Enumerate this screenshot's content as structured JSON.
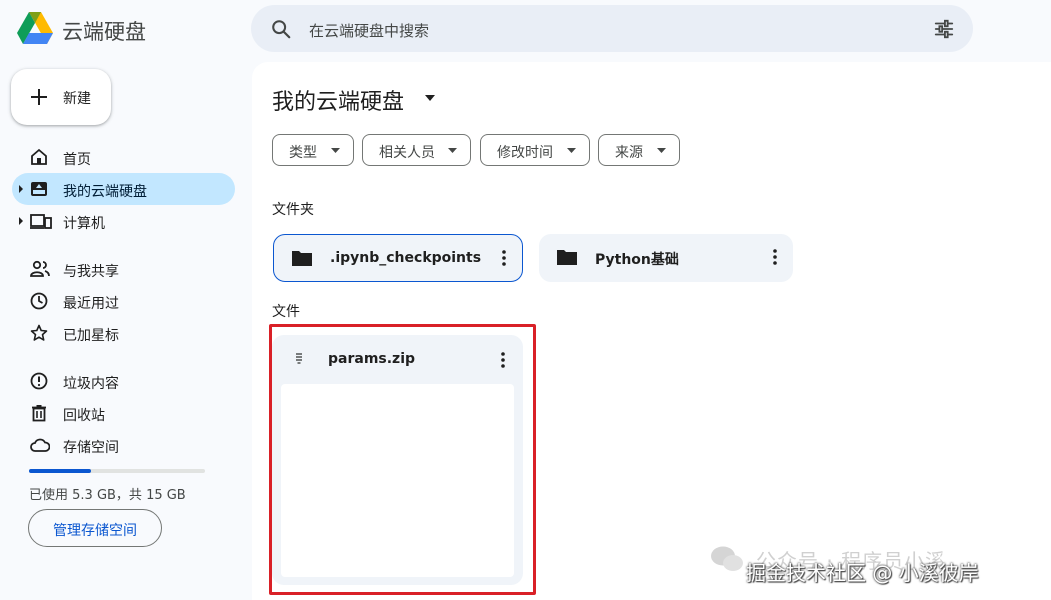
{
  "header": {
    "app_title": "云端硬盘",
    "search_placeholder": "在云端硬盘中搜索"
  },
  "sidebar": {
    "new_label": "新建",
    "items": [
      {
        "label": "首页",
        "icon": "home-icon"
      },
      {
        "label": "我的云端硬盘",
        "icon": "my-drive-icon",
        "active": true
      },
      {
        "label": "计算机",
        "icon": "computer-icon"
      },
      {
        "label": "与我共享",
        "icon": "shared-icon"
      },
      {
        "label": "最近用过",
        "icon": "clock-icon"
      },
      {
        "label": "已加星标",
        "icon": "star-icon"
      },
      {
        "label": "垃圾内容",
        "icon": "spam-icon"
      },
      {
        "label": "回收站",
        "icon": "trash-icon"
      },
      {
        "label": "存储空间",
        "icon": "cloud-icon"
      }
    ],
    "storage": {
      "text": "已使用 5.3 GB，共 15 GB",
      "used_fraction": 0.353,
      "manage_label": "管理存储空间"
    }
  },
  "main": {
    "title": "我的云端硬盘",
    "filters": [
      "类型",
      "相关人员",
      "修改时间",
      "来源"
    ],
    "folders_label": "文件夹",
    "folders": [
      {
        "name": ".ipynb_checkpoints",
        "selected": true
      },
      {
        "name": "Python基础",
        "selected": false
      }
    ],
    "files_label": "文件",
    "files": [
      {
        "name": "params.zip"
      }
    ]
  },
  "watermark": {
    "line1": "公众号 · 程序员小溪",
    "line2": "掘金技术社区 @ 小溪彼岸"
  },
  "colors": {
    "accent": "#0b57d0",
    "active_nav": "#c2e7ff",
    "highlight_box": "#d92027",
    "search_bg": "#e9eef6"
  }
}
